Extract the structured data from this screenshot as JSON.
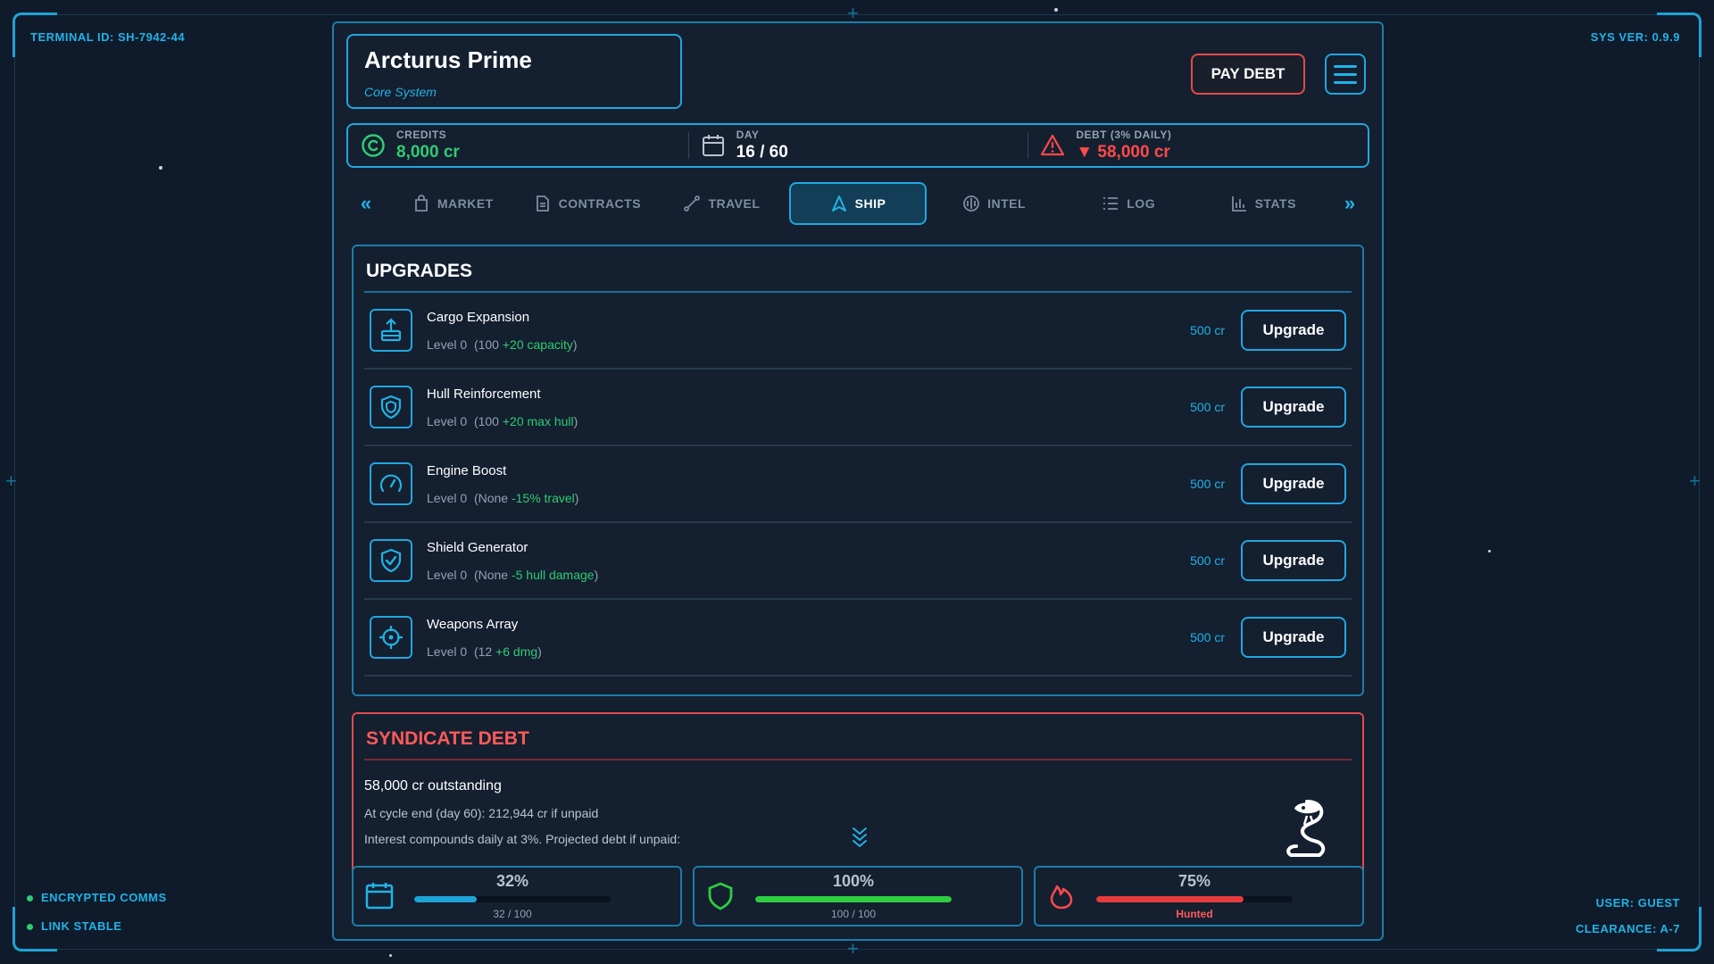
{
  "terminal": {
    "id_label": "TERMINAL ID: SH-7942-44",
    "sys_ver": "SYS VER: 0.9.9",
    "status_lines": [
      "ENCRYPTED COMMS",
      "LINK STABLE"
    ],
    "user": "USER: GUEST",
    "clearance": "CLEARANCE: A-7"
  },
  "location": {
    "name": "Arcturus Prime",
    "subtitle": "Core System"
  },
  "header": {
    "pay_debt_label": "PAY DEBT",
    "menu_icon": "hamburger-menu-icon"
  },
  "stats": {
    "credits": {
      "label": "CREDITS",
      "value": "8,000 cr",
      "icon": "credits-icon"
    },
    "day": {
      "label": "DAY",
      "value": "16 / 60",
      "icon": "calendar-icon"
    },
    "debt": {
      "label": "DEBT (3% DAILY)",
      "value": "▼ 58,000 cr",
      "icon": "warning-icon"
    }
  },
  "tabs": [
    {
      "label": "MARKET",
      "icon": "bag-icon",
      "active": false
    },
    {
      "label": "CONTRACTS",
      "icon": "document-icon",
      "active": false
    },
    {
      "label": "TRAVEL",
      "icon": "route-icon",
      "active": false
    },
    {
      "label": "SHIP",
      "icon": "ship-icon",
      "active": true
    },
    {
      "label": "INTEL",
      "icon": "intel-icon",
      "active": false
    },
    {
      "label": "LOG",
      "icon": "list-icon",
      "active": false
    },
    {
      "label": "STATS",
      "icon": "bar-chart-icon",
      "active": false
    }
  ],
  "upgrades": {
    "title": "UPGRADES",
    "button_label": "Upgrade",
    "items": [
      {
        "name": "Cargo Expansion",
        "level": "Level 0",
        "current": "(100",
        "bonus": "+20 capacity",
        "close": ")",
        "cost": "500 cr",
        "icon": "cargo-icon"
      },
      {
        "name": "Hull Reinforcement",
        "level": "Level 0",
        "current": "(100",
        "bonus": "+20 max hull",
        "close": ")",
        "cost": "500 cr",
        "icon": "shield-icon"
      },
      {
        "name": "Engine Boost",
        "level": "Level 0",
        "current": "(None",
        "bonus": "-15% travel",
        "close": ")",
        "cost": "500 cr",
        "icon": "gauge-icon"
      },
      {
        "name": "Shield Generator",
        "level": "Level 0",
        "current": "(None",
        "bonus": "-5 hull damage",
        "close": ")",
        "cost": "500 cr",
        "icon": "shield-check-icon"
      },
      {
        "name": "Weapons Array",
        "level": "Level 0",
        "current": "(12",
        "bonus": "+6 dmg",
        "close": ")",
        "cost": "500 cr",
        "icon": "crosshair-icon"
      }
    ]
  },
  "debt_panel": {
    "title": "SYNDICATE DEBT",
    "outstanding": "58,000 cr outstanding",
    "projection": "At cycle end (day 60): 212,944 cr if unpaid",
    "interest_note": "Interest compounds daily at 3%. Projected debt if unpaid:"
  },
  "bottom_stats": [
    {
      "pct": "32%",
      "sub": "32 / 100",
      "fill": 0.32,
      "color": "#1fa3d6",
      "icon": "cargo-hold-icon"
    },
    {
      "pct": "100%",
      "sub": "100 / 100",
      "fill": 1.0,
      "color": "#2ecc40",
      "icon": "hull-shield-icon"
    },
    {
      "pct": "75%",
      "sub": "Hunted",
      "fill": 0.75,
      "color": "#e63b3b",
      "icon": "flame-icon"
    }
  ],
  "colors": {
    "accent": "#21a7df",
    "danger": "#e24b4b",
    "success": "#2ecc71",
    "background": "#0f1b2b"
  }
}
